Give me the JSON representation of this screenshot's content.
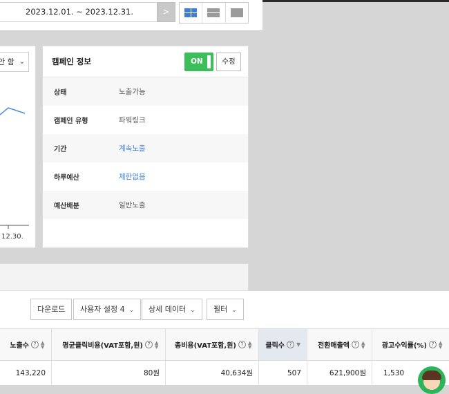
{
  "date_range": {
    "text": "2023.12.01. ~ 2023.12.31.",
    "next": ">"
  },
  "view_toggle": {
    "icons": [
      "grid-view-icon",
      "rows-view-icon",
      "single-view-icon"
    ]
  },
  "chart": {
    "select_text": "안 함",
    "tick_label": "12.30."
  },
  "campaign": {
    "title": "캠페인 정보",
    "toggle": "ON",
    "edit": "수정",
    "rows": [
      {
        "label": "상태",
        "value": "노출가능"
      },
      {
        "label": "캠페인 유형",
        "value": "파워링크"
      },
      {
        "label": "기간",
        "value": "계속노출"
      },
      {
        "label": "하루예산",
        "value": "제한없음"
      },
      {
        "label": "예산배분",
        "value": "일반노출"
      }
    ],
    "link_color": "#3d7fd8",
    "on_color": "#3cbe5a"
  },
  "actions": {
    "download": "다운로드",
    "user_setting": "사용자 설정 4",
    "detail_data": "상세 데이터",
    "filter": "필터"
  },
  "table": {
    "headers": [
      "노출수",
      "평균클릭비용(VAT포함,원)",
      "총비용(VAT포함,원)",
      "클릭수",
      "전환매출액",
      "광고수익률(%)"
    ],
    "row": [
      "143,220",
      "80원",
      "40,634원",
      "507",
      "621,900원",
      "1,530"
    ]
  }
}
